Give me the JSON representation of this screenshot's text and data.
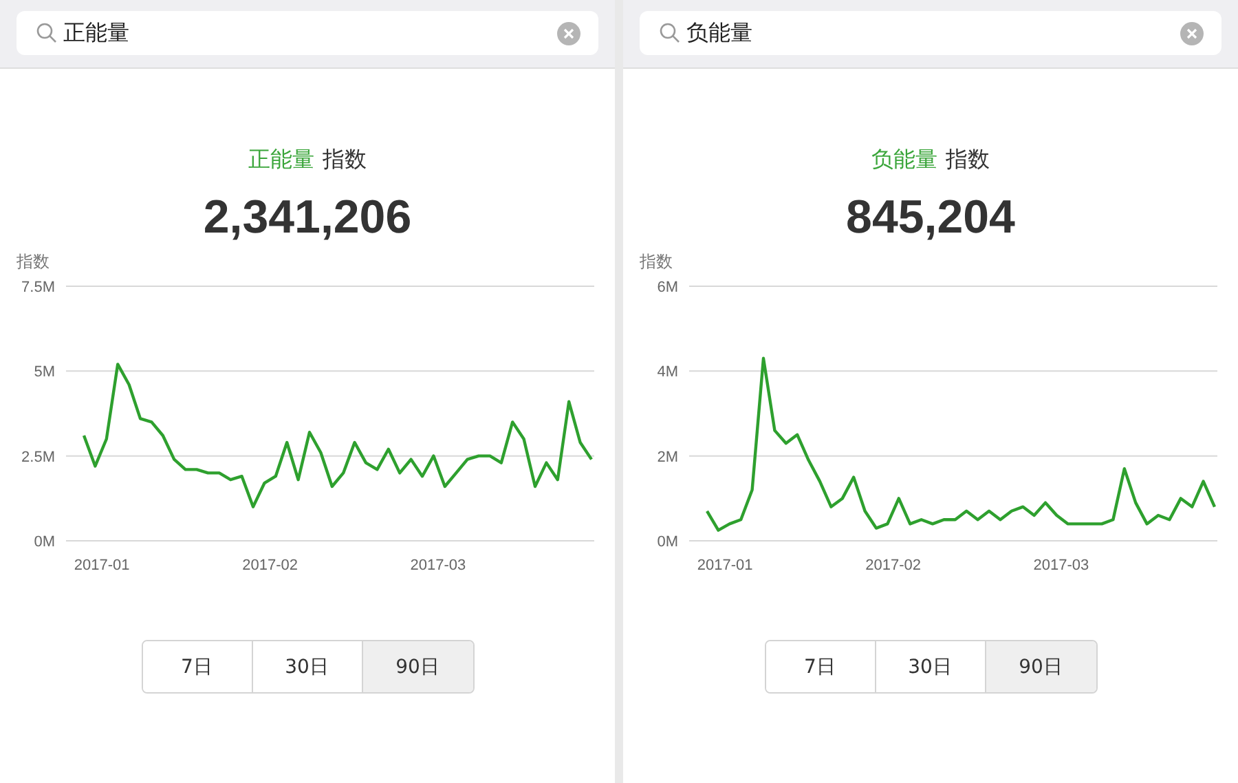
{
  "panels": [
    {
      "search": {
        "value": "正能量"
      },
      "title": {
        "keyword": "正能量",
        "label": "指数"
      },
      "total": "2,341,206",
      "x_axis_labels": [
        "2017-01",
        "2017-02",
        "2017-03"
      ],
      "chart_data": {
        "type": "line",
        "ylabel": "指数",
        "ylim": [
          0,
          7.5
        ],
        "yticks": [
          {
            "value": 0,
            "label": "0M"
          },
          {
            "value": 2.5,
            "label": "2.5M"
          },
          {
            "value": 5,
            "label": "5M"
          },
          {
            "value": 7.5,
            "label": "7.5M"
          }
        ],
        "series": [
          {
            "color": "#2ea02e",
            "values": [
              3.1,
              2.2,
              3.0,
              5.2,
              4.6,
              3.6,
              3.5,
              3.1,
              2.4,
              2.1,
              2.1,
              2.0,
              2.0,
              1.8,
              1.9,
              1.0,
              1.7,
              1.9,
              2.9,
              1.8,
              3.2,
              2.6,
              1.6,
              2.0,
              2.9,
              2.3,
              2.1,
              2.7,
              2.0,
              2.4,
              1.9,
              2.5,
              1.6,
              2.0,
              2.4,
              2.5,
              2.5,
              2.3,
              3.5,
              3.0,
              1.6,
              2.3,
              1.8,
              4.1,
              2.9,
              2.4
            ]
          }
        ]
      },
      "ranges": [
        {
          "label": "7日",
          "selected": false
        },
        {
          "label": "30日",
          "selected": false
        },
        {
          "label": "90日",
          "selected": true
        }
      ]
    },
    {
      "search": {
        "value": "负能量"
      },
      "title": {
        "keyword": "负能量",
        "label": "指数"
      },
      "total": "845,204",
      "x_axis_labels": [
        "2017-01",
        "2017-02",
        "2017-03"
      ],
      "chart_data": {
        "type": "line",
        "ylabel": "指数",
        "ylim": [
          0,
          6
        ],
        "yticks": [
          {
            "value": 0,
            "label": "0M"
          },
          {
            "value": 2,
            "label": "2M"
          },
          {
            "value": 4,
            "label": "4M"
          },
          {
            "value": 6,
            "label": "6M"
          }
        ],
        "series": [
          {
            "color": "#2ea02e",
            "values": [
              0.7,
              0.25,
              0.4,
              0.5,
              1.2,
              4.3,
              2.6,
              2.3,
              2.5,
              1.9,
              1.4,
              0.8,
              1.0,
              1.5,
              0.7,
              0.3,
              0.4,
              1.0,
              0.4,
              0.5,
              0.4,
              0.5,
              0.5,
              0.7,
              0.5,
              0.7,
              0.5,
              0.7,
              0.8,
              0.6,
              0.9,
              0.6,
              0.4,
              0.4,
              0.4,
              0.4,
              0.5,
              1.7,
              0.9,
              0.4,
              0.6,
              0.5,
              1.0,
              0.8,
              1.4,
              0.8
            ]
          }
        ]
      },
      "ranges": [
        {
          "label": "7日",
          "selected": false
        },
        {
          "label": "30日",
          "selected": false
        },
        {
          "label": "90日",
          "selected": true
        }
      ]
    }
  ]
}
